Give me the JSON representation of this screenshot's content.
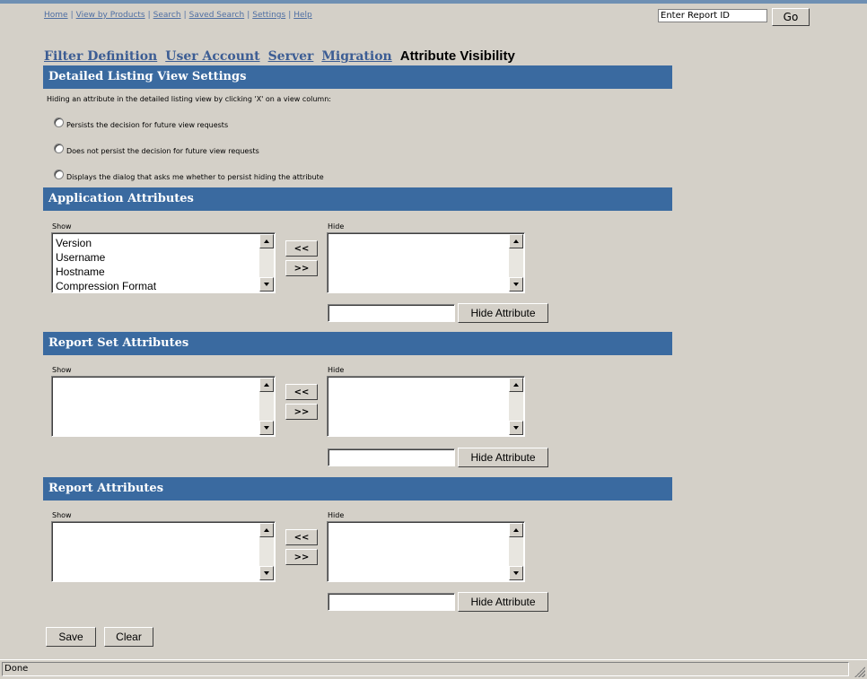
{
  "nav": {
    "links": [
      "Home",
      "View by Products",
      "Search",
      "Saved Search",
      "Settings",
      "Help"
    ],
    "report_id_value": "Enter Report ID",
    "go_label": "Go"
  },
  "tabs": {
    "filter_definition": "Filter Definition",
    "user_account": "User Account",
    "server": "Server",
    "migration": "Migration",
    "active": "Attribute Visibility"
  },
  "detailed_listing": {
    "title": "Detailed Listing View Settings",
    "description": "Hiding an attribute in the detailed listing view by clicking 'X' on a view column:",
    "options": [
      "Persists the decision for future view requests",
      "Does not persist the decision for future view requests",
      "Displays the dialog that asks me whether to persist hiding the attribute"
    ]
  },
  "application_attributes": {
    "title": "Application Attributes",
    "show_label": "Show",
    "hide_label": "Hide",
    "show_items": [
      "Version",
      "Username",
      "Hostname",
      "Compression Format"
    ],
    "move_left": "<<",
    "move_right": ">>",
    "hide_button": "Hide Attribute"
  },
  "report_set_attributes": {
    "title": "Report Set Attributes",
    "show_label": "Show",
    "hide_label": "Hide",
    "move_left": "<<",
    "move_right": ">>",
    "hide_button": "Hide Attribute"
  },
  "report_attributes": {
    "title": "Report Attributes",
    "show_label": "Show",
    "hide_label": "Hide",
    "move_left": "<<",
    "move_right": ">>",
    "hide_button": "Hide Attribute"
  },
  "actions": {
    "save": "Save",
    "clear": "Clear"
  },
  "status": {
    "text": "Done"
  },
  "colors": {
    "section_bar": "#3a6aa0",
    "link": "#4f6fa3",
    "tab_link": "#3c5d94",
    "background": "#d4d0c8"
  }
}
